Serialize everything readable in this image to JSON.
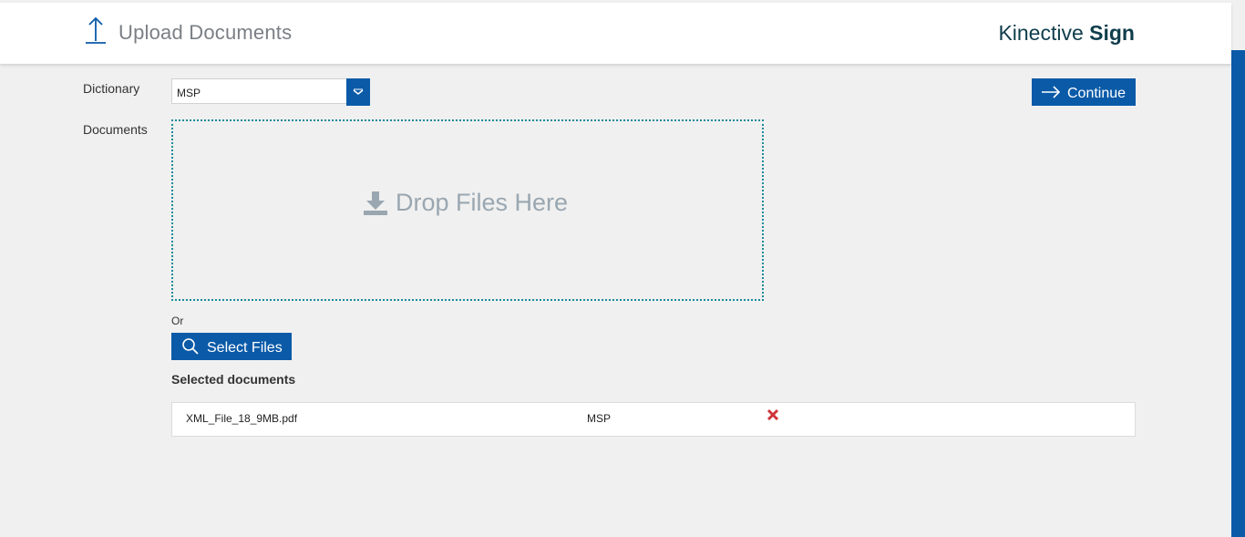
{
  "header": {
    "title": "Upload Documents",
    "brand_light": "Kinective",
    "brand_bold": "Sign"
  },
  "form": {
    "dictionary_label": "Dictionary",
    "dictionary_value": "MSP",
    "documents_label": "Documents",
    "continue_label": "Continue",
    "dropzone_text": "Drop Files Here",
    "or_text": "Or",
    "select_files_label": "Select Files"
  },
  "selected": {
    "title": "Selected documents",
    "rows": [
      {
        "file_name": "XML_File_18_9MB.pdf",
        "dictionary": "MSP"
      }
    ]
  },
  "icons": {
    "header": "upload-arrow-icon",
    "dropdown": "chevron-down-icon",
    "continue": "arrow-right-icon",
    "dropzone": "download-icon",
    "select_files": "search-icon",
    "delete": "close-icon"
  },
  "colors": {
    "accent": "#0a5aa8",
    "brand_text": "#0f3d4c",
    "dropzone_border": "#1a8a9a",
    "delete": "#d0343a",
    "background": "#f0f0f0"
  }
}
